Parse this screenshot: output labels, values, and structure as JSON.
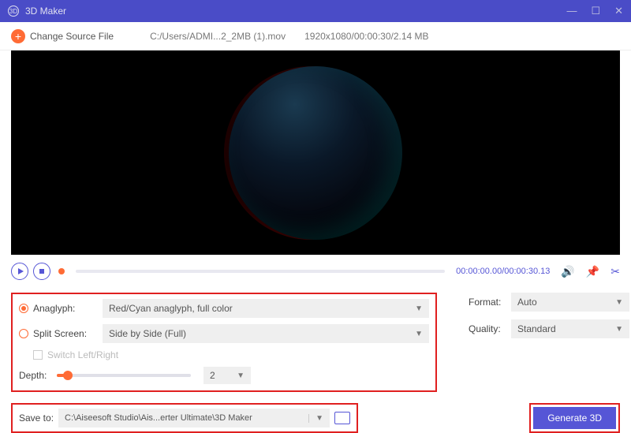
{
  "titlebar": {
    "title": "3D Maker"
  },
  "toolbar": {
    "change_label": "Change Source File",
    "path": "C:/Users/ADMI...2_2MB (1).mov",
    "meta": "1920x1080/00:00:30/2.14 MB"
  },
  "transport": {
    "current": "00:00:00.00",
    "total": "00:00:30.13"
  },
  "options": {
    "anaglyph_label": "Anaglyph:",
    "anaglyph_value": "Red/Cyan anaglyph, full color",
    "split_label": "Split Screen:",
    "split_value": "Side by Side (Full)",
    "switch_label": "Switch Left/Right",
    "depth_label": "Depth:",
    "depth_value": "2",
    "format_label": "Format:",
    "format_value": "Auto",
    "quality_label": "Quality:",
    "quality_value": "Standard"
  },
  "save": {
    "label": "Save to:",
    "path": "C:\\Aiseesoft Studio\\Ais...erter Ultimate\\3D Maker"
  },
  "actions": {
    "generate": "Generate 3D"
  }
}
